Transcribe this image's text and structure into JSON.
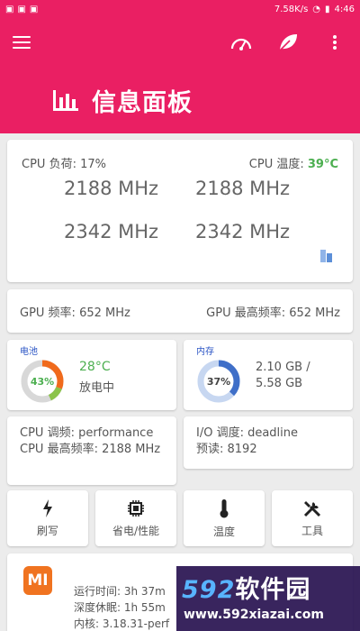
{
  "status_bar": {
    "left_icons": [
      "notification-icon",
      "notification-icon",
      "notification-icon"
    ],
    "speed": "7.58K/s",
    "time": "4:46"
  },
  "header": {
    "title": "信息面板"
  },
  "cpu": {
    "load_label": "CPU 负荷: 17%",
    "temp_label": "CPU 温度: ",
    "temp_value": "39°C",
    "freqs": [
      "2188 MHz",
      "2188 MHz",
      "2342 MHz",
      "2342 MHz"
    ]
  },
  "gpu": {
    "freq_label": "GPU 频率: 652 MHz",
    "max_freq_label": "GPU 最高频率: 652 MHz"
  },
  "battery": {
    "title": "电池",
    "percent": 43,
    "percent_label": "43%",
    "temp": "28°C",
    "status": "放电中"
  },
  "memory": {
    "title": "内存",
    "percent": 37,
    "percent_label": "37%",
    "used": "2.10 GB /",
    "total": "5.58 GB"
  },
  "governor": {
    "cpu_governor": "CPU 调频: performance",
    "cpu_max_freq": "CPU 最高频率: 2188 MHz"
  },
  "io": {
    "scheduler": "I/O 调度: deadline",
    "readahead": "预读: 8192"
  },
  "actions": [
    {
      "label": "刷写",
      "icon": "flash-icon"
    },
    {
      "label": "省电/性能",
      "icon": "chip-icon"
    },
    {
      "label": "温度",
      "icon": "thermometer-icon"
    },
    {
      "label": "工具",
      "icon": "tools-icon"
    }
  ],
  "device": {
    "logo": "MI",
    "uptime": "运行时间: 3h 37m",
    "deep_sleep": "深度休眠: 1h 55m",
    "kernel": "内核: 3.18.31-perf"
  },
  "watermark": {
    "brand_num": "592",
    "brand_text": "软件园",
    "url": "www.592xiazai.com"
  },
  "colors": {
    "primary": "#ea1f63",
    "accent_green": "#4caf50",
    "memory_blue": "#3f6fc8"
  }
}
